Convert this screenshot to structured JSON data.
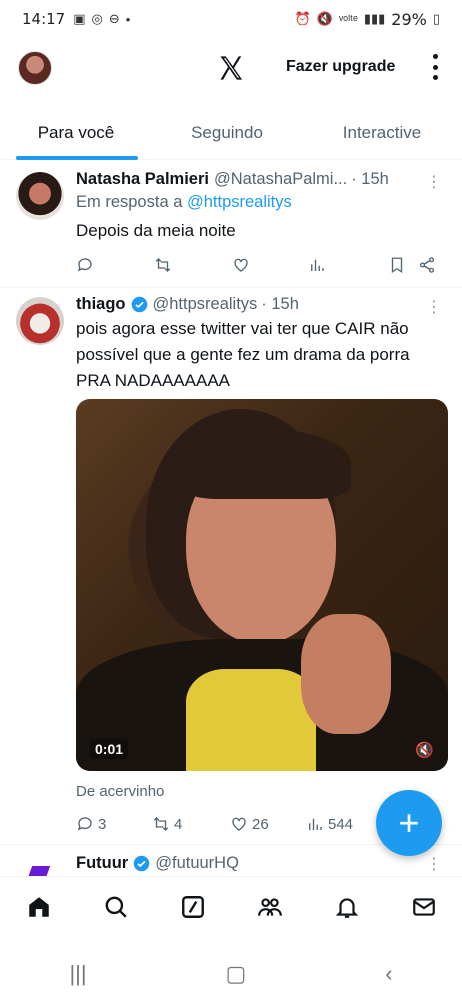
{
  "status_bar": {
    "time": "14:17",
    "battery": "29%"
  },
  "header": {
    "upgrade_label": "Fazer upgrade"
  },
  "tabs": [
    {
      "label": "Para você"
    },
    {
      "label": "Seguindo"
    },
    {
      "label": "Interactive"
    }
  ],
  "tweets": [
    {
      "name": "Natasha Palmieri",
      "handle": "@NatashaPalmi...",
      "time": "· 15h",
      "reply_prefix": "Em resposta a",
      "reply_mention": "@httpsrealitys",
      "text": "Depois da meia noite"
    },
    {
      "name": "thiago",
      "handle": "@httpsrealitys",
      "time": "· 15h",
      "text": "pois agora esse twitter vai ter que CAIR não possível que a gente fez um drama da porra PRA NADAAAAAAA",
      "video_time": "0:01",
      "source": "De acervinho",
      "replies": "3",
      "retweets": "4",
      "likes": "26",
      "views": "544"
    },
    {
      "name": "Futuur",
      "handle": "@futuurHQ"
    }
  ],
  "colors": {
    "accent": "#1d9bf0",
    "text_primary": "#0f1419",
    "text_secondary": "#536471"
  }
}
